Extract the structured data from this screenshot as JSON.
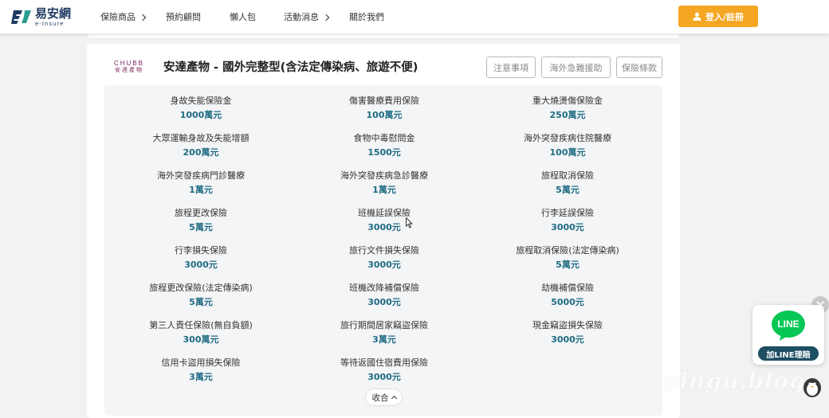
{
  "header": {
    "logo_cn": "易安網",
    "logo_en": "e-Insure",
    "nav": [
      {
        "label": "保險商品",
        "has_dropdown": true
      },
      {
        "label": "預約顧問",
        "has_dropdown": false
      },
      {
        "label": "懶人包",
        "has_dropdown": false
      },
      {
        "label": "活動消息",
        "has_dropdown": true
      },
      {
        "label": "關於我們",
        "has_dropdown": false
      }
    ],
    "login_label": "登入/註冊"
  },
  "plan": {
    "insurer_logo_en": "CHUBB",
    "insurer_logo_cn": "安達產物",
    "title": "安達產物 - 國外完整型(含法定傳染病、旅遊不便)",
    "buttons": {
      "notes": "注意事項",
      "emergency": "海外急難援助",
      "terms": "保險條款"
    }
  },
  "coverage": [
    {
      "name": "身故失能保險金",
      "amount": "1000萬元"
    },
    {
      "name": "傷害醫療費用保險",
      "amount": "100萬元"
    },
    {
      "name": "重大燒燙傷保險金",
      "amount": "250萬元"
    },
    {
      "name": "大眾運輸身故及失能增額",
      "amount": "200萬元"
    },
    {
      "name": "食物中毒慰問金",
      "amount": "1500元"
    },
    {
      "name": "海外突發疾病住院醫療",
      "amount": "100萬元"
    },
    {
      "name": "海外突發疾病門診醫療",
      "amount": "1萬元"
    },
    {
      "name": "海外突發疾病急診醫療",
      "amount": "1萬元"
    },
    {
      "name": "旅程取消保險",
      "amount": "5萬元"
    },
    {
      "name": "旅程更改保險",
      "amount": "5萬元"
    },
    {
      "name": "班機延誤保險",
      "amount": "3000元"
    },
    {
      "name": "行李延誤保險",
      "amount": "3000元"
    },
    {
      "name": "行李損失保險",
      "amount": "3000元"
    },
    {
      "name": "旅行文件損失保險",
      "amount": "3000元"
    },
    {
      "name": "旅程取消保險(法定傳染病)",
      "amount": "5萬元"
    },
    {
      "name": "旅程更改保險(法定傳染病)",
      "amount": "5萬元"
    },
    {
      "name": "班機改降補償保險",
      "amount": "3000元"
    },
    {
      "name": "劫機補償保險",
      "amount": "5000元"
    },
    {
      "name": "第三人責任保險(無自負額)",
      "amount": "300萬元"
    },
    {
      "name": "旅行期間居家竊盜保險",
      "amount": "3萬元"
    },
    {
      "name": "現金竊盜損失保險",
      "amount": "3000元"
    },
    {
      "name": "信用卡盜用損失保險",
      "amount": "3萬元"
    },
    {
      "name": "等待返國住宿費用保險",
      "amount": "3000元"
    }
  ],
  "collapse_label": "收合",
  "line_widget": {
    "logo_text": "LINE",
    "label": "加LINE理賠"
  },
  "watermark": "pingu.blog",
  "colors": {
    "accent": "#f5a623",
    "amount_teal": "#1e6b82",
    "line_green": "#06c755",
    "line_badge": "#1e4e62",
    "chubb_purple": "#7a1f5c"
  }
}
